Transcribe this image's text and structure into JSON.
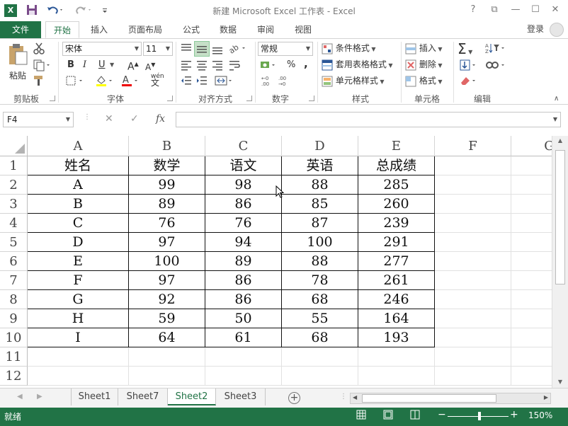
{
  "title_bar": {
    "title": "新建 Microsoft Excel 工作表 - Excel",
    "app_logo": "X",
    "help": "?",
    "restore_ribbon": "⧉",
    "minimize": "—",
    "maximize": "☐",
    "close": "✕"
  },
  "ribbon_tabs": {
    "file": "文件",
    "items": [
      "开始",
      "插入",
      "页面布局",
      "公式",
      "数据",
      "审阅",
      "视图"
    ],
    "login": "登录"
  },
  "clipboard": {
    "paste": "粘贴",
    "group_label": "剪贴板"
  },
  "font": {
    "name": "宋体",
    "size": "11",
    "bold": "B",
    "italic": "I",
    "underline": "U",
    "grow": "A",
    "shrink": "A",
    "wen": "wén",
    "group_label": "字体"
  },
  "alignment": {
    "group_label": "对齐方式"
  },
  "number": {
    "format": "常规",
    "percent": "%",
    "comma": ",",
    "group_label": "数字"
  },
  "styles": {
    "conditional": "条件格式",
    "table_format": "套用表格格式",
    "cell_styles": "单元格样式",
    "group_label": "样式"
  },
  "cells": {
    "insert": "插入",
    "delete": "删除",
    "format": "格式",
    "group_label": "单元格"
  },
  "editing": {
    "group_label": "编辑"
  },
  "formula_bar": {
    "name_box": "F4",
    "cancel": "✕",
    "enter": "✓",
    "fx": "fx",
    "value": ""
  },
  "columns": [
    "A",
    "B",
    "C",
    "D",
    "E",
    "F",
    "G"
  ],
  "rows": [
    "1",
    "2",
    "3",
    "4",
    "5",
    "6",
    "7",
    "8",
    "9",
    "10",
    "11",
    "12"
  ],
  "table": {
    "header": [
      "姓名",
      "数学",
      "语文",
      "英语",
      "总成绩"
    ],
    "rows": [
      [
        "A",
        "99",
        "98",
        "88",
        "285"
      ],
      [
        "B",
        "89",
        "86",
        "85",
        "260"
      ],
      [
        "C",
        "76",
        "76",
        "87",
        "239"
      ],
      [
        "D",
        "97",
        "94",
        "100",
        "291"
      ],
      [
        "E",
        "100",
        "89",
        "88",
        "277"
      ],
      [
        "F",
        "97",
        "86",
        "78",
        "261"
      ],
      [
        "G",
        "92",
        "86",
        "68",
        "246"
      ],
      [
        "H",
        "59",
        "50",
        "55",
        "164"
      ],
      [
        "I",
        "64",
        "61",
        "68",
        "193"
      ]
    ]
  },
  "sheets": {
    "tabs": [
      "Sheet1",
      "Sheet7",
      "Sheet2",
      "Sheet3"
    ],
    "active": "Sheet2"
  },
  "status_bar": {
    "ready": "就绪",
    "zoom_minus": "−",
    "zoom_plus": "+",
    "zoom": "150%"
  },
  "colors": {
    "accent": "#217346"
  }
}
